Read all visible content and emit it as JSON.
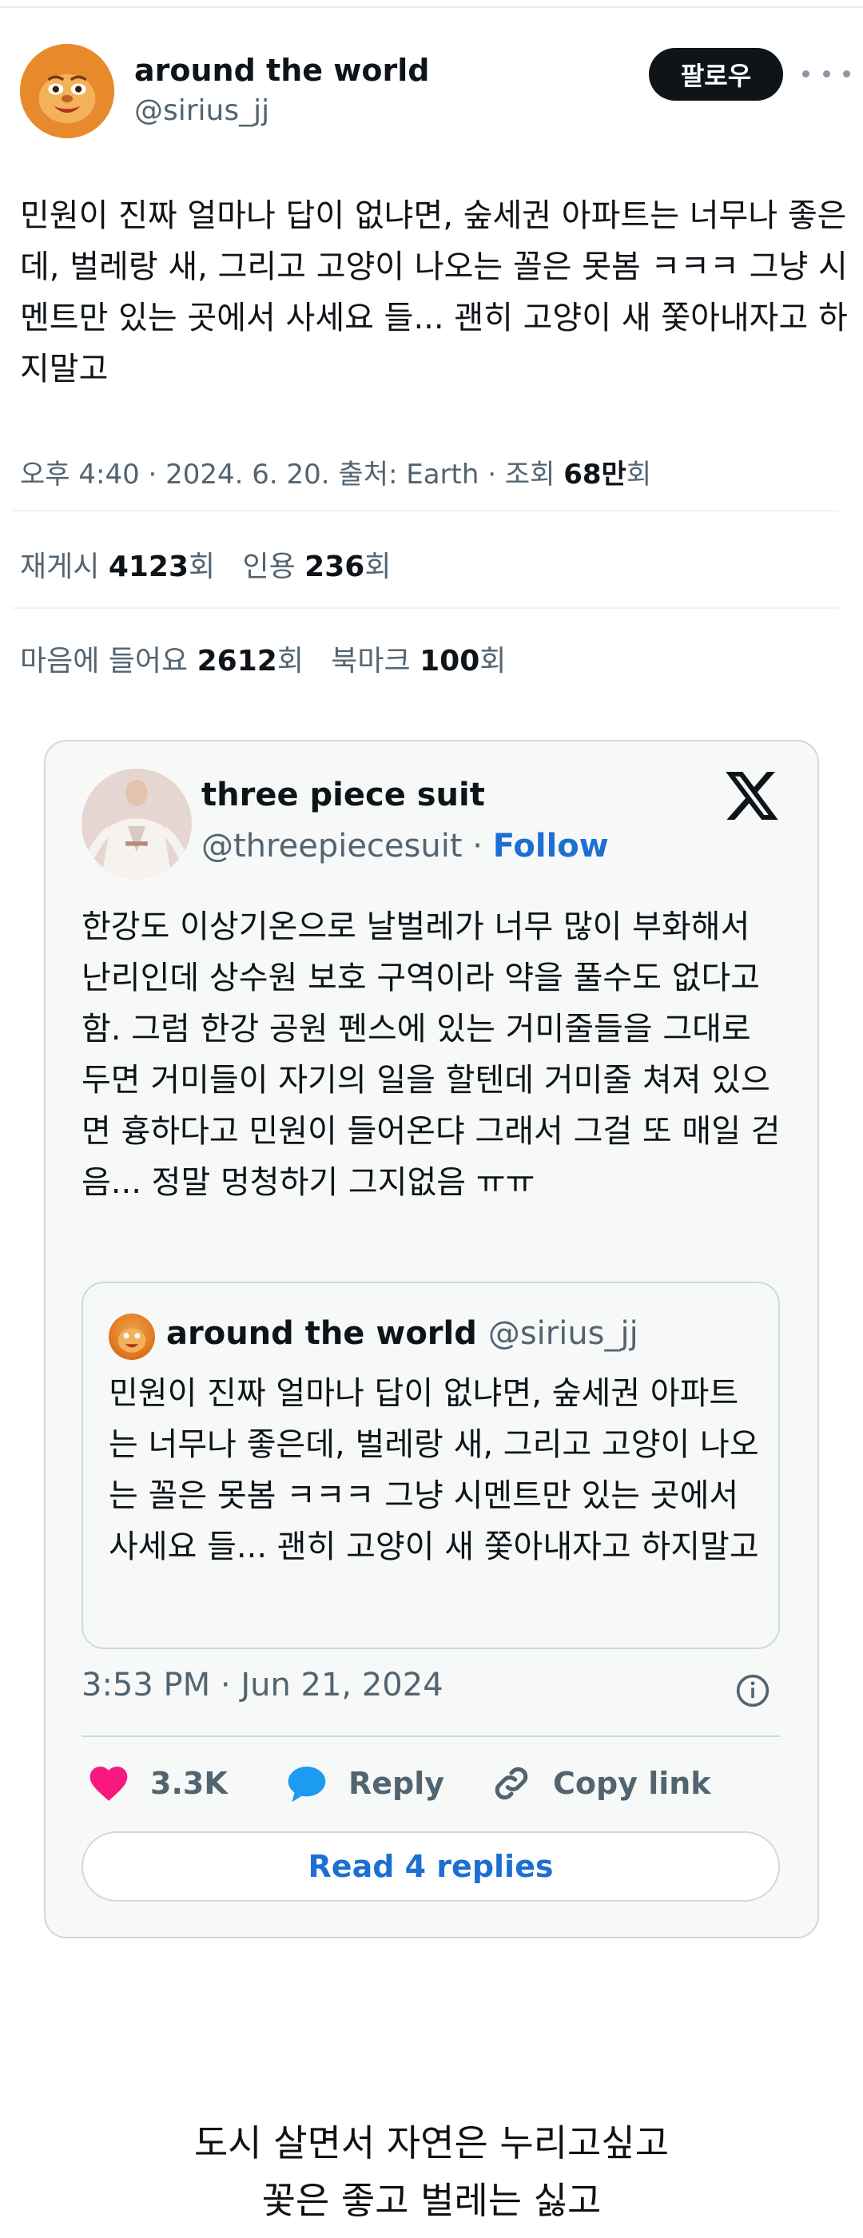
{
  "main_tweet": {
    "display_name": "around the world",
    "handle": "@sirius_jj",
    "follow_label": "팔로우",
    "text": "민원이 진짜 얼마나 답이 없냐면, 숲세권 아파트는 너무나 좋은데, 벌레랑 새, 그리고 고양이 나오는 꼴은 못봄 ㅋㅋㅋ 그냥 시멘트만 있는 곳에서 사세요 들... 괜히 고양이 새 쫓아내자고 하지말고",
    "meta_prefix": "오후 4:40 · 2024. 6. 20. 출처: Earth · 조회 ",
    "views_value": "68만",
    "views_suffix": "회",
    "retweets_label": "재게시 ",
    "retweets_value": "4123",
    "retweets_suffix": "회",
    "quotes_label": "인용 ",
    "quotes_value": "236",
    "quotes_suffix": "회",
    "likes_label": "마음에 들어요 ",
    "likes_value": "2612",
    "likes_suffix": "회",
    "bookmarks_label": "북마크 ",
    "bookmarks_value": "100",
    "bookmarks_suffix": "회"
  },
  "embed_card": {
    "display_name": "three piece suit",
    "handle": "@threepiecesuit",
    "dot": " · ",
    "follow_label": "Follow",
    "text": "한강도 이상기온으로 날벌레가 너무 많이 부화해서 난리인데 상수원 보호 구역이라 약을 풀수도 없다고 함. 그럼 한강 공원 펜스에 있는 거미줄들을 그대로 두면 거미들이 자기의 일을 할텐데 거미줄 쳐져 있으면 흉하다고 민원이 들어온댜 그래서 그걸 또 매일 걷음... 정말 멍청하기 그지없음 ㅠㅠ",
    "quoted": {
      "display_name": "around the world",
      "handle": "@sirius_jj",
      "text": "민원이 진짜 얼마나 답이 없냐면, 숲세권 아파트는 너무나 좋은데, 벌레랑 새, 그리고 고양이 나오는 꼴은 못봄 ㅋㅋㅋ 그냥 시멘트만 있는 곳에서 사세요 들... 괜히 고양이 새 쫓아내자고 하지말고"
    },
    "timestamp": "3:53 PM · Jun 21, 2024",
    "like_count": "3.3K",
    "reply_label": "Reply",
    "copy_label": "Copy link",
    "read_replies_label": "Read 4 replies"
  },
  "caption": {
    "line1": "도시 살면서 자연은 누리고싶고",
    "line2": "꽃은 좋고 벌레는 싫고"
  },
  "colors": {
    "link_blue": "#1d6fd1",
    "like_pink": "#f91880",
    "reply_blue": "#1d9bf0",
    "muted_gray": "#536471"
  }
}
